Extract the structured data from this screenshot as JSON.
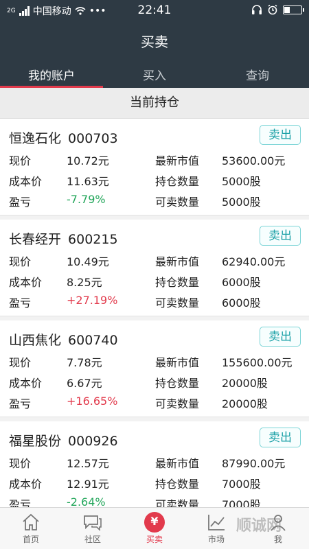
{
  "status": {
    "network": "2G",
    "carrier": "中国移动",
    "dots": "•••",
    "time": "22:41",
    "battery_level": 0.35
  },
  "header": {
    "title": "买卖",
    "tabs": [
      {
        "label": "我的账户",
        "active": true
      },
      {
        "label": "买入",
        "active": false
      },
      {
        "label": "查询",
        "active": false
      }
    ]
  },
  "section": {
    "title": "当前持仓"
  },
  "labels": {
    "price": "现价",
    "cost": "成本价",
    "pnl": "盈亏",
    "market_value": "最新市值",
    "holding": "持仓数量",
    "sellable": "可卖数量",
    "sell": "卖出"
  },
  "holdings": [
    {
      "name": "恒逸石化",
      "code": "000703",
      "price": "10.72元",
      "cost": "11.63元",
      "pnl": "-7.79%",
      "pnl_sign": "neg",
      "market_value": "53600.00元",
      "holding": "5000股",
      "sellable": "5000股"
    },
    {
      "name": "长春经开",
      "code": "600215",
      "price": "10.49元",
      "cost": "8.25元",
      "pnl": "+27.19%",
      "pnl_sign": "pos",
      "market_value": "62940.00元",
      "holding": "6000股",
      "sellable": "6000股"
    },
    {
      "name": "山西焦化",
      "code": "600740",
      "price": "7.78元",
      "cost": "6.67元",
      "pnl": "+16.65%",
      "pnl_sign": "pos",
      "market_value": "155600.00元",
      "holding": "20000股",
      "sellable": "20000股"
    },
    {
      "name": "福星股份",
      "code": "000926",
      "price": "12.57元",
      "cost": "12.91元",
      "pnl": "-2.64%",
      "pnl_sign": "neg",
      "market_value": "87990.00元",
      "holding": "7000股",
      "sellable": "7000股"
    }
  ],
  "nav": [
    {
      "label": "首页",
      "icon": "home-icon"
    },
    {
      "label": "社区",
      "icon": "chat-icon"
    },
    {
      "label": "买卖",
      "icon": "yen-coin-icon",
      "active": true
    },
    {
      "label": "市场",
      "icon": "chart-icon"
    },
    {
      "label": "我",
      "icon": "user-icon"
    }
  ],
  "watermark": "顺诚网",
  "colors": {
    "header_bg": "#2e3a44",
    "accent": "#e23a4c",
    "gain": "#e23a4c",
    "loss": "#22a65a",
    "sell_button": "#1aa0a6"
  }
}
